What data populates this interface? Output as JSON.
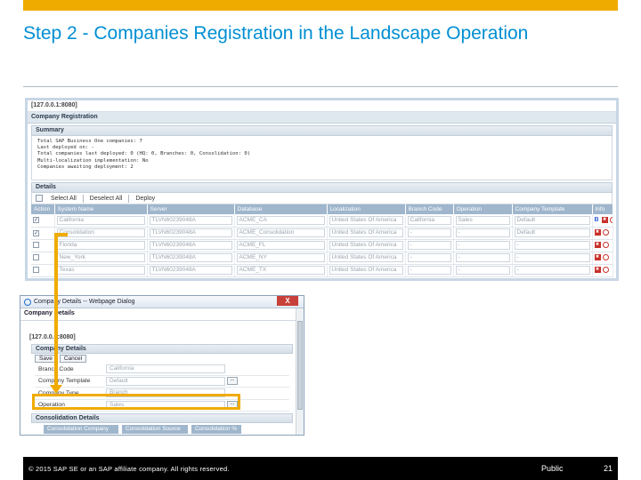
{
  "slide": {
    "title": "Step 2 - Companies Registration in the Landscape Operation"
  },
  "screen1": {
    "address": "[127.0.0.1:8080]",
    "header": "Company Registration",
    "summary_title": "Summary",
    "summary_lines": [
      "Total SAP Business One companies: 7",
      "Last deployed on: -",
      "Total companies last deployed: 0 (HQ: 0, Branches: 0, Consolidation: 0)",
      "Multi-localization implementation: No",
      "Companies awaiting deployment: 2"
    ],
    "details_title": "Details",
    "toolbar": {
      "select_all": "Select All",
      "deselect_all": "Deselect All",
      "deploy": "Deploy"
    },
    "columns": [
      "Action",
      "System Name",
      "Server",
      "Database",
      "Localization",
      "Branch Code",
      "Operation",
      "Company Template",
      "Info"
    ],
    "rows": [
      {
        "checked": true,
        "check_mark": "✓",
        "system": "California",
        "server": "TLVN60239048A",
        "database": "ACME_CA",
        "localization": "United States Of America",
        "branch": "California",
        "operation": "Sales",
        "template": "Default",
        "info_b": true
      },
      {
        "checked": true,
        "check_mark": "✓",
        "system": "Consolidation",
        "server": "TLVN60239048A",
        "database": "ACME_Consolidation",
        "localization": "United States Of America",
        "branch": "-",
        "operation": "-",
        "template": "Default",
        "info_b": false
      },
      {
        "checked": false,
        "check_mark": "",
        "system": "Florida",
        "server": "TLVN60239048A",
        "database": "ACME_FL",
        "localization": "United States Of America",
        "branch": "-",
        "operation": "-",
        "template": "-",
        "info_b": false
      },
      {
        "checked": false,
        "check_mark": "",
        "system": "New_York",
        "server": "TLVN60239048A",
        "database": "ACME_NY",
        "localization": "United States Of America",
        "branch": "-",
        "operation": "-",
        "template": "-",
        "info_b": false
      },
      {
        "checked": false,
        "check_mark": "",
        "system": "Texas",
        "server": "TLVN60239048A",
        "database": "ACME_TX",
        "localization": "United States Of America",
        "branch": "-",
        "operation": "-",
        "template": "-",
        "info_b": false
      }
    ],
    "info_b_label": "B",
    "info_x_label": "✖"
  },
  "dialog": {
    "window_title": "Company Details -- Webpage Dialog",
    "close_label": "X",
    "header": "Company Details",
    "address": "[127.0.0.1:8080]",
    "section_title": "Company Details",
    "save_label": "Save",
    "cancel_label": "Cancel",
    "fields": [
      {
        "label": "Branch Code",
        "value": "California",
        "has_picker": false
      },
      {
        "label": "Company Template",
        "value": "Default",
        "has_picker": true
      },
      {
        "label": "Company Type",
        "value": "Branch",
        "has_picker": false
      },
      {
        "label": "Operation",
        "value": "Sales",
        "has_picker": true
      }
    ],
    "picker_label": "...",
    "consolidation_title": "Consolidation Details",
    "consolidation_columns": [
      "Consolidation Company",
      "Consolidation Source",
      "Consolidation %"
    ]
  },
  "footer": {
    "copyright": "© 2015 SAP SE or an SAP affiliate company. All rights reserved.",
    "classification": "Public",
    "page_number": "21"
  },
  "colors": {
    "accent": "#f0ab00",
    "title": "#008fd3",
    "grid_header": "#9fb6cc"
  }
}
